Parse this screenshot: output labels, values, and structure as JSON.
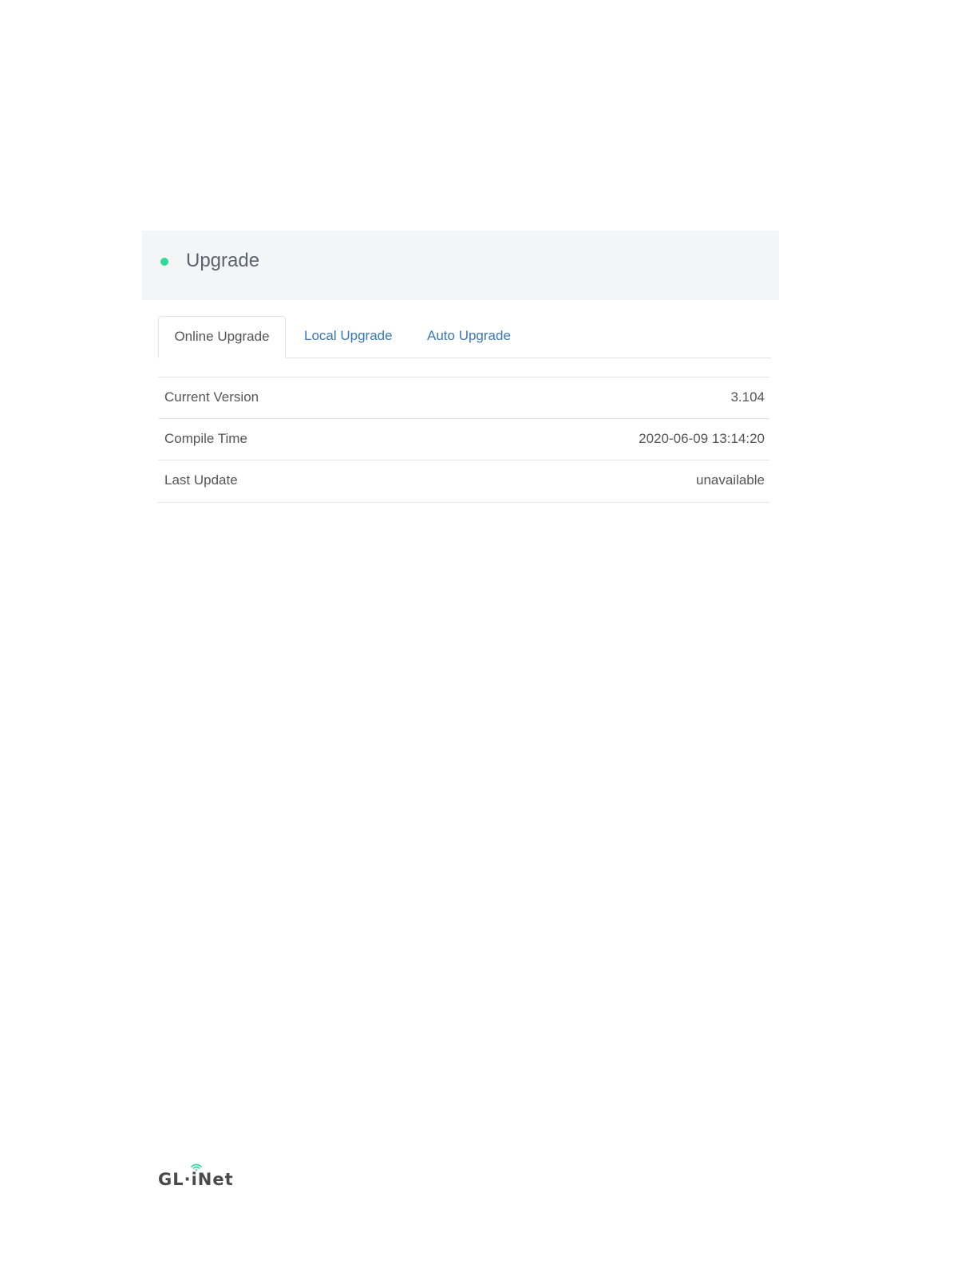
{
  "header": {
    "title": "Upgrade",
    "dot_color": "#2bdc9a"
  },
  "tabs": [
    {
      "label": "Online Upgrade",
      "active": true
    },
    {
      "label": "Local Upgrade",
      "active": false
    },
    {
      "label": "Auto Upgrade",
      "active": false
    }
  ],
  "info": {
    "rows": [
      {
        "label": "Current Version",
        "value": "3.104"
      },
      {
        "label": "Compile Time",
        "value": "2020-06-09 13:14:20"
      },
      {
        "label": "Last Update",
        "value": "unavailable"
      }
    ]
  },
  "footer": {
    "logo_text": "GL·iNet",
    "logo_icon": "wifi-icon",
    "accent_color": "#2bdc9a"
  }
}
